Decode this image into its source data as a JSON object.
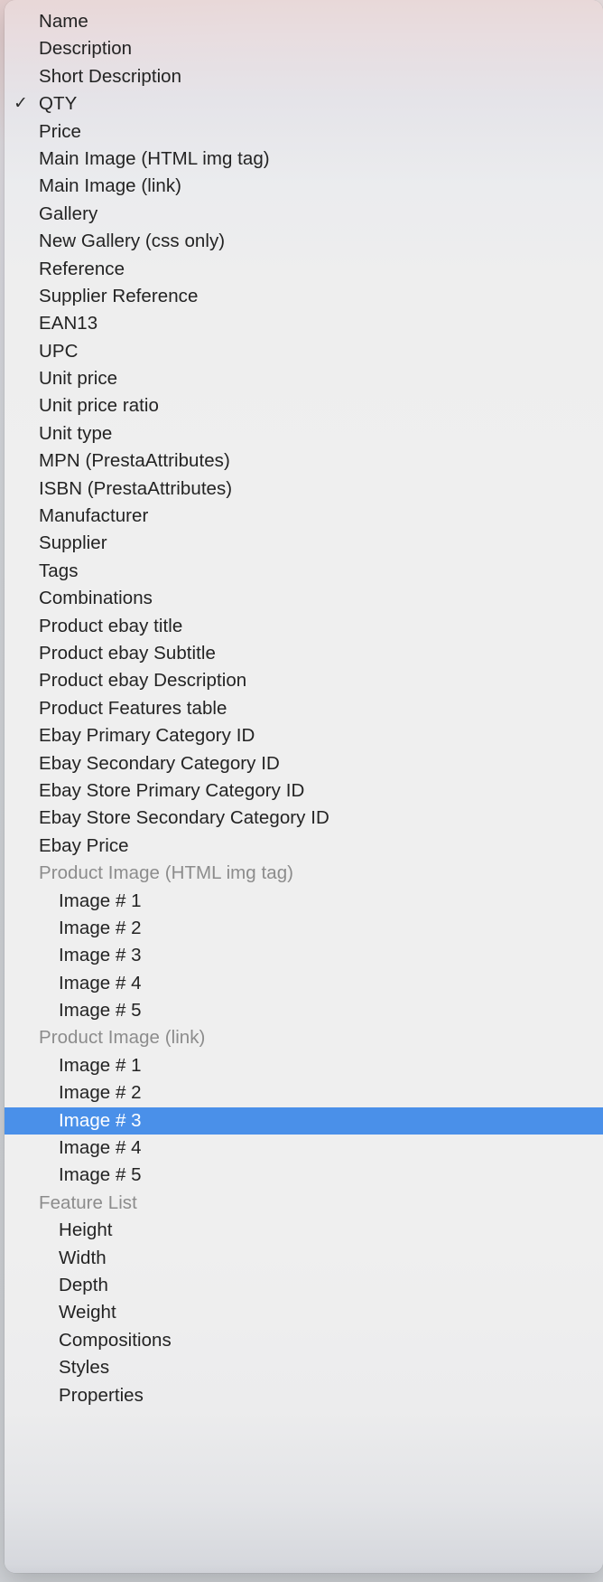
{
  "menu": {
    "name": "field-selection-context-menu",
    "selection_color": "#4a90e9",
    "selected_text_color": "#ffffff",
    "group_text_color": "#8c8c8c",
    "item_text_color": "#232323",
    "check_glyph": "✓",
    "items": [
      {
        "label": "Name",
        "checked": false,
        "indent": false,
        "group": false,
        "selected": false
      },
      {
        "label": "Description",
        "checked": false,
        "indent": false,
        "group": false,
        "selected": false
      },
      {
        "label": "Short Description",
        "checked": false,
        "indent": false,
        "group": false,
        "selected": false
      },
      {
        "label": "QTY",
        "checked": true,
        "indent": false,
        "group": false,
        "selected": false
      },
      {
        "label": "Price",
        "checked": false,
        "indent": false,
        "group": false,
        "selected": false
      },
      {
        "label": "Main Image (HTML img tag)",
        "checked": false,
        "indent": false,
        "group": false,
        "selected": false
      },
      {
        "label": "Main Image (link)",
        "checked": false,
        "indent": false,
        "group": false,
        "selected": false
      },
      {
        "label": "Gallery",
        "checked": false,
        "indent": false,
        "group": false,
        "selected": false
      },
      {
        "label": "New Gallery (css only)",
        "checked": false,
        "indent": false,
        "group": false,
        "selected": false
      },
      {
        "label": "Reference",
        "checked": false,
        "indent": false,
        "group": false,
        "selected": false
      },
      {
        "label": "Supplier Reference",
        "checked": false,
        "indent": false,
        "group": false,
        "selected": false
      },
      {
        "label": "EAN13",
        "checked": false,
        "indent": false,
        "group": false,
        "selected": false
      },
      {
        "label": "UPC",
        "checked": false,
        "indent": false,
        "group": false,
        "selected": false
      },
      {
        "label": "Unit price",
        "checked": false,
        "indent": false,
        "group": false,
        "selected": false
      },
      {
        "label": "Unit price ratio",
        "checked": false,
        "indent": false,
        "group": false,
        "selected": false
      },
      {
        "label": "Unit type",
        "checked": false,
        "indent": false,
        "group": false,
        "selected": false
      },
      {
        "label": "MPN (PrestaAttributes)",
        "checked": false,
        "indent": false,
        "group": false,
        "selected": false
      },
      {
        "label": "ISBN (PrestaAttributes)",
        "checked": false,
        "indent": false,
        "group": false,
        "selected": false
      },
      {
        "label": "Manufacturer",
        "checked": false,
        "indent": false,
        "group": false,
        "selected": false
      },
      {
        "label": "Supplier",
        "checked": false,
        "indent": false,
        "group": false,
        "selected": false
      },
      {
        "label": "Tags",
        "checked": false,
        "indent": false,
        "group": false,
        "selected": false
      },
      {
        "label": "Combinations",
        "checked": false,
        "indent": false,
        "group": false,
        "selected": false
      },
      {
        "label": "Product ebay title",
        "checked": false,
        "indent": false,
        "group": false,
        "selected": false
      },
      {
        "label": "Product ebay Subtitle",
        "checked": false,
        "indent": false,
        "group": false,
        "selected": false
      },
      {
        "label": "Product ebay Description",
        "checked": false,
        "indent": false,
        "group": false,
        "selected": false
      },
      {
        "label": "Product Features table",
        "checked": false,
        "indent": false,
        "group": false,
        "selected": false
      },
      {
        "label": "Ebay Primary Category ID",
        "checked": false,
        "indent": false,
        "group": false,
        "selected": false
      },
      {
        "label": "Ebay Secondary Category ID",
        "checked": false,
        "indent": false,
        "group": false,
        "selected": false
      },
      {
        "label": "Ebay Store Primary Category ID",
        "checked": false,
        "indent": false,
        "group": false,
        "selected": false
      },
      {
        "label": "Ebay Store Secondary Category ID",
        "checked": false,
        "indent": false,
        "group": false,
        "selected": false
      },
      {
        "label": "Ebay Price",
        "checked": false,
        "indent": false,
        "group": false,
        "selected": false
      },
      {
        "label": "Product Image (HTML img tag)",
        "checked": false,
        "indent": false,
        "group": true,
        "selected": false
      },
      {
        "label": "Image # 1",
        "checked": false,
        "indent": true,
        "group": false,
        "selected": false
      },
      {
        "label": "Image # 2",
        "checked": false,
        "indent": true,
        "group": false,
        "selected": false
      },
      {
        "label": "Image # 3",
        "checked": false,
        "indent": true,
        "group": false,
        "selected": false
      },
      {
        "label": "Image # 4",
        "checked": false,
        "indent": true,
        "group": false,
        "selected": false
      },
      {
        "label": "Image # 5",
        "checked": false,
        "indent": true,
        "group": false,
        "selected": false
      },
      {
        "label": "Product Image (link)",
        "checked": false,
        "indent": false,
        "group": true,
        "selected": false
      },
      {
        "label": "Image # 1",
        "checked": false,
        "indent": true,
        "group": false,
        "selected": false
      },
      {
        "label": "Image # 2",
        "checked": false,
        "indent": true,
        "group": false,
        "selected": false
      },
      {
        "label": "Image # 3",
        "checked": false,
        "indent": true,
        "group": false,
        "selected": true
      },
      {
        "label": "Image # 4",
        "checked": false,
        "indent": true,
        "group": false,
        "selected": false
      },
      {
        "label": "Image # 5",
        "checked": false,
        "indent": true,
        "group": false,
        "selected": false
      },
      {
        "label": "Feature List",
        "checked": false,
        "indent": false,
        "group": true,
        "selected": false
      },
      {
        "label": "Height",
        "checked": false,
        "indent": true,
        "group": false,
        "selected": false
      },
      {
        "label": "Width",
        "checked": false,
        "indent": true,
        "group": false,
        "selected": false
      },
      {
        "label": "Depth",
        "checked": false,
        "indent": true,
        "group": false,
        "selected": false
      },
      {
        "label": "Weight",
        "checked": false,
        "indent": true,
        "group": false,
        "selected": false
      },
      {
        "label": "Compositions",
        "checked": false,
        "indent": true,
        "group": false,
        "selected": false
      },
      {
        "label": "Styles",
        "checked": false,
        "indent": true,
        "group": false,
        "selected": false
      },
      {
        "label": "Properties",
        "checked": false,
        "indent": true,
        "group": false,
        "selected": false
      }
    ]
  }
}
